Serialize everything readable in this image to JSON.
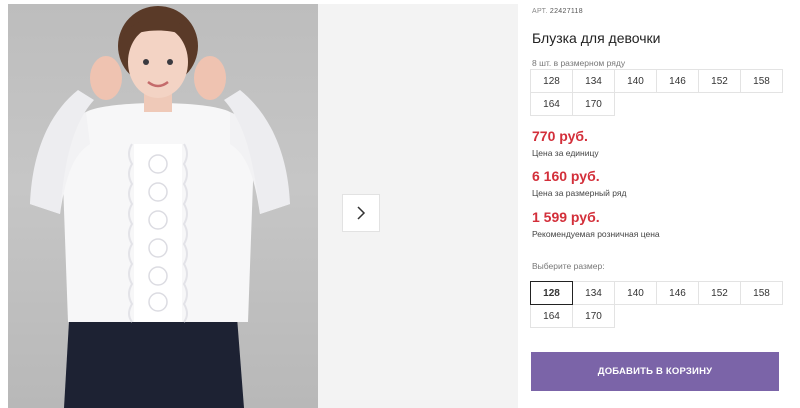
{
  "product": {
    "art_label": "АРТ.",
    "art_number": "22427118",
    "title": "Блузка для девочки"
  },
  "pack": {
    "label": "8 шт. в размерном ряду",
    "sizes": [
      "128",
      "134",
      "140",
      "146",
      "152",
      "158",
      "164",
      "170"
    ]
  },
  "prices": {
    "unit_price": "770 руб.",
    "unit_caption": "Цена за единицу",
    "pack_price": "6 160 руб.",
    "pack_caption": "Цена за размерный ряд",
    "retail_price": "1 599 руб.",
    "retail_caption": "Рекомендуемая розничная цена"
  },
  "size_select": {
    "label": "Выберите размер:",
    "options": [
      "128",
      "134",
      "140",
      "146",
      "152",
      "158",
      "164",
      "170"
    ],
    "selected": "128"
  },
  "cart": {
    "add_label": "ДОБАВИТЬ В КОРЗИНУ"
  },
  "colors": {
    "price": "#d32f3a",
    "button": "#7b64a8"
  },
  "icons": {
    "gallery_next": "chevron-right-icon"
  }
}
